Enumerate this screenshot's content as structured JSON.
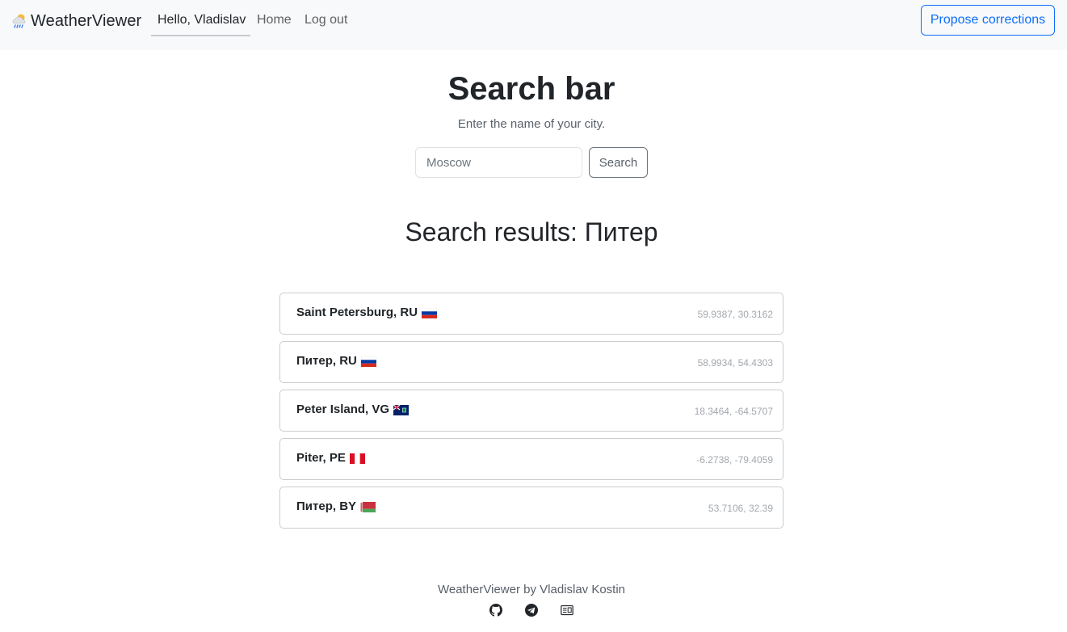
{
  "navbar": {
    "brand": "WeatherViewer",
    "brand_icon": "cloud-rain-sun-icon",
    "greeting": "Hello, Vladislav",
    "home": "Home",
    "logout": "Log out",
    "propose": "Propose corrections",
    "accent_color": "#0d6efd"
  },
  "search": {
    "title": "Search bar",
    "subtitle": "Enter the name of your city.",
    "placeholder": "Moscow",
    "value": "",
    "button": "Search"
  },
  "results": {
    "title": "Search results: Питер",
    "items": [
      {
        "name": "Saint Petersburg, RU",
        "flag": "ru-flag-icon",
        "coords": "59.9387, 30.3162"
      },
      {
        "name": "Питер, RU",
        "flag": "ru-flag-icon",
        "coords": "58.9934, 54.4303"
      },
      {
        "name": "Peter Island, VG",
        "flag": "vg-flag-icon",
        "coords": "18.3464, -64.5707"
      },
      {
        "name": "Piter, PE",
        "flag": "pe-flag-icon",
        "coords": "-6.2738, -79.4059"
      },
      {
        "name": "Питер, BY",
        "flag": "by-flag-icon",
        "coords": "53.7106, 32.39"
      }
    ]
  },
  "footer": {
    "text": "WeatherViewer by Vladislav Kostin",
    "icons": [
      "github-icon",
      "telegram-icon",
      "resume-icon"
    ]
  }
}
